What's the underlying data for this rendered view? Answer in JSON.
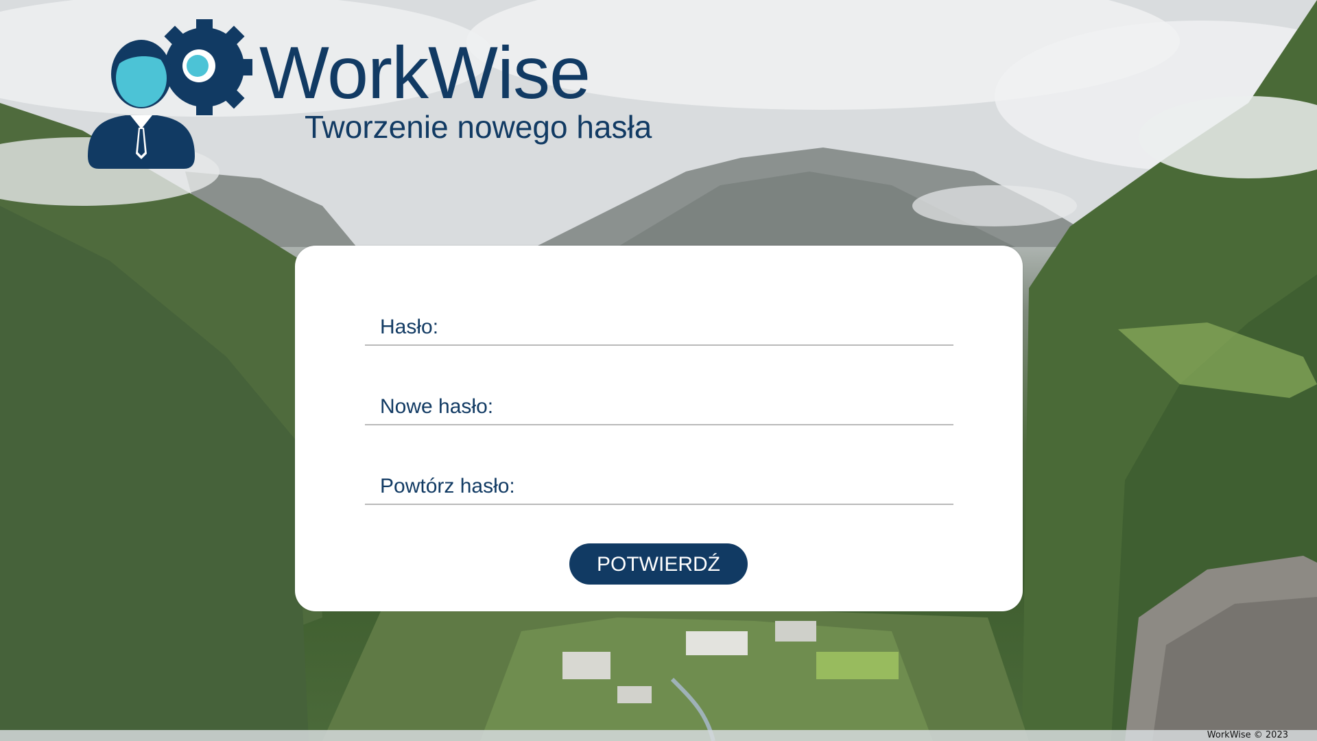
{
  "app": {
    "title": "WorkWise",
    "subtitle": "Tworzenie nowego hasła"
  },
  "form": {
    "fields": [
      {
        "label": "Hasło:",
        "value": ""
      },
      {
        "label": "Nowe hasło:",
        "value": ""
      },
      {
        "label": "Powtórz hasło:",
        "value": ""
      }
    ],
    "confirm_label": "POTWIERDŹ"
  },
  "footer": {
    "text": "WorkWise © 2023"
  },
  "colors": {
    "brand_dark": "#113a63",
    "brand_accent": "#4cc3d6",
    "card_bg": "#ffffff"
  },
  "icons": {
    "logo": "businessman-gear-logo-icon"
  }
}
